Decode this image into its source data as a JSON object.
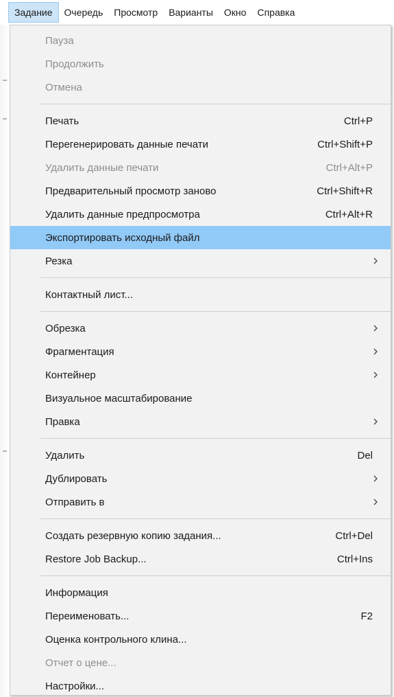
{
  "menubar": {
    "items": [
      {
        "label": "Задание",
        "active": true
      },
      {
        "label": "Очередь"
      },
      {
        "label": "Просмотр"
      },
      {
        "label": "Варианты"
      },
      {
        "label": "Окно"
      },
      {
        "label": "Справка"
      }
    ]
  },
  "menu": {
    "group1": [
      {
        "label": "Пауза",
        "disabled": true
      },
      {
        "label": "Продолжить",
        "disabled": true
      },
      {
        "label": "Отмена",
        "disabled": true
      }
    ],
    "group2": [
      {
        "label": "Печать",
        "shortcut": "Ctrl+P"
      },
      {
        "label": "Перегенерировать данные печати",
        "shortcut": "Ctrl+Shift+P"
      },
      {
        "label": "Удалить данные печати",
        "shortcut": "Ctrl+Alt+P",
        "disabled": true
      },
      {
        "label": "Предварительный просмотр заново",
        "shortcut": "Ctrl+Shift+R"
      },
      {
        "label": "Удалить данные предпросмотра",
        "shortcut": "Ctrl+Alt+R"
      },
      {
        "label": "Экспортировать исходный файл",
        "highlighted": true
      },
      {
        "label": "Резка",
        "submenu": true
      }
    ],
    "group3": [
      {
        "label": "Контактный лист..."
      }
    ],
    "group4": [
      {
        "label": "Обрезка",
        "submenu": true
      },
      {
        "label": "Фрагментация",
        "submenu": true
      },
      {
        "label": "Контейнер",
        "submenu": true
      },
      {
        "label": "Визуальное масштабирование"
      },
      {
        "label": "Правка",
        "submenu": true
      }
    ],
    "group5": [
      {
        "label": "Удалить",
        "shortcut": "Del"
      },
      {
        "label": "Дублировать",
        "submenu": true
      },
      {
        "label": "Отправить в",
        "submenu": true
      }
    ],
    "group6": [
      {
        "label": "Создать резервную копию задания...",
        "shortcut": "Ctrl+Del"
      },
      {
        "label": "Restore Job Backup...",
        "shortcut": "Ctrl+Ins"
      }
    ],
    "group7": [
      {
        "label": "Информация"
      },
      {
        "label": "Переименовать...",
        "shortcut": "F2"
      },
      {
        "label": "Оценка контрольного клина..."
      },
      {
        "label": "Отчет о цене...",
        "disabled": true
      },
      {
        "label": "Настройки..."
      }
    ]
  },
  "colors": {
    "highlight": "#91c9f7",
    "menu_bg": "#f2f2f2",
    "disabled_text": "#8d8d8d",
    "active_menubar_bg": "#cce4f7"
  },
  "icons": {
    "submenu": "chevron-right-icon"
  }
}
